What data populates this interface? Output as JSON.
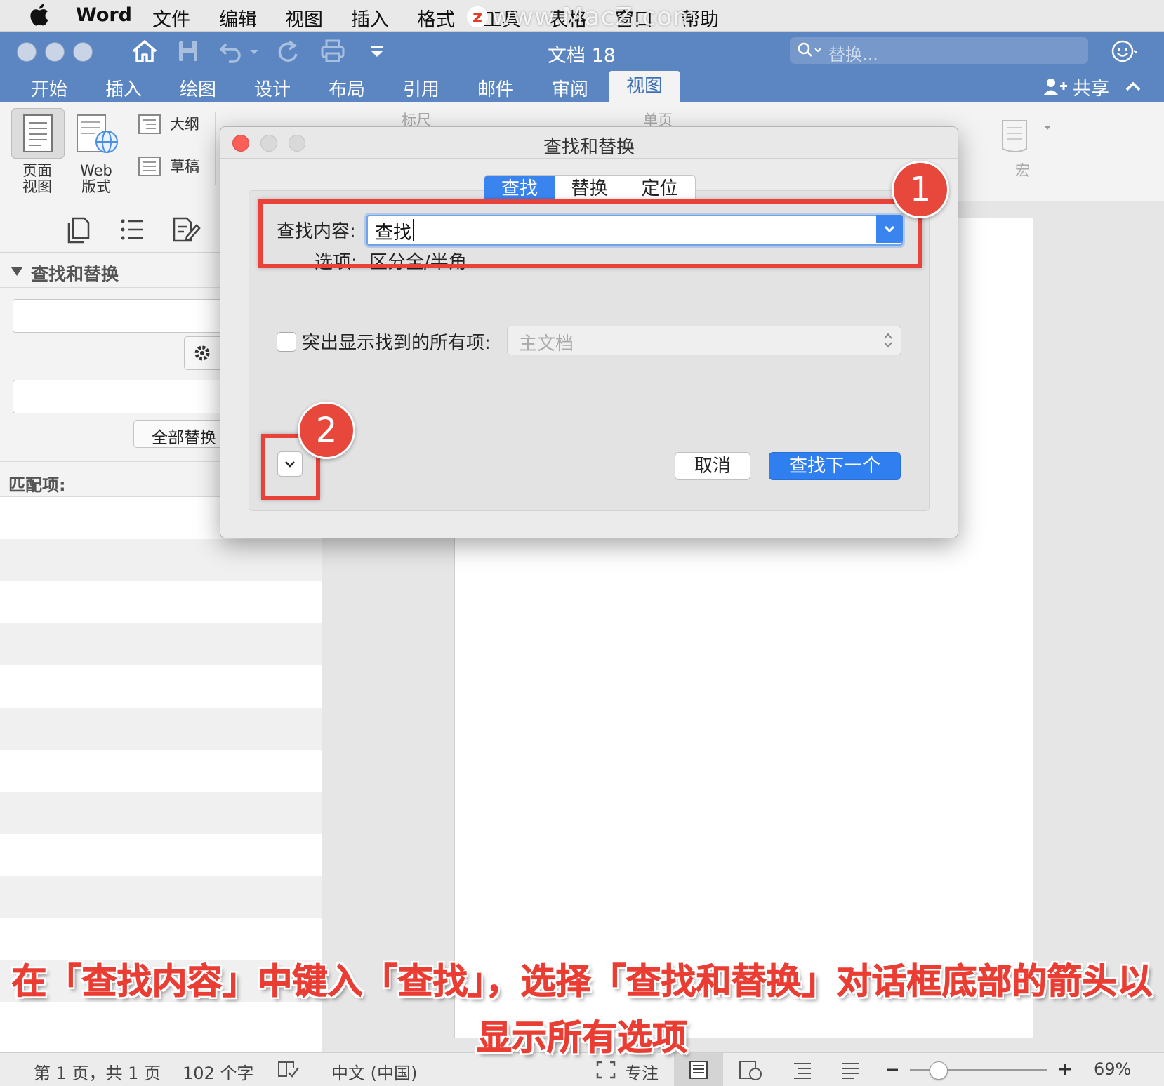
{
  "menubar": {
    "app": "Word",
    "items": [
      "文件",
      "编辑",
      "视图",
      "插入",
      "格式",
      "工具",
      "表格",
      "窗口",
      "帮助"
    ],
    "watermark": "www.MacZ.com",
    "watermark_logo": "z"
  },
  "window": {
    "title": "文档 18",
    "search_placeholder": "替换...",
    "share_label": "共享"
  },
  "ribbon": {
    "tabs": [
      "开始",
      "插入",
      "绘图",
      "设计",
      "布局",
      "引用",
      "邮件",
      "审阅",
      "视图"
    ],
    "active_tab": "视图",
    "view_items": {
      "page_view": "页面\n视图",
      "web_view": "Web\n版式",
      "outline": "大纲",
      "draft": "草稿",
      "ruler": "标尺",
      "single_page": "单页",
      "macro": "宏"
    }
  },
  "left_pane": {
    "section_title": "查找和替换",
    "replace_all_label": "全部替换",
    "matches_label": "匹配项:"
  },
  "dialog": {
    "title": "查找和替换",
    "tabs": [
      "查找",
      "替换",
      "定位"
    ],
    "active_tab": "查找",
    "find_label": "查找内容:",
    "find_value": "查找",
    "options_label": "选项:",
    "options_value": "区分全/半角",
    "highlight_label": "突出显示找到的所有项:",
    "highlight_checked": false,
    "scope_value": "主文档",
    "cancel_label": "取消",
    "find_next_label": "查找下一个"
  },
  "annotations": {
    "badge_1": "1",
    "badge_2": "2",
    "caption_line1": "在「查找内容」中键入「查找」，选择「查找和替换」对话框底部的箭头以",
    "caption_line2": "显示所有选项",
    "accent_color": "#e8423a"
  },
  "statusbar": {
    "page": "第 1 页，共 1 页",
    "words": "102 个字",
    "language": "中文 (中国)",
    "focus": "专注",
    "zoom_text": "69%",
    "zoom_level": 0.69
  },
  "colors": {
    "titlebar": "#5b86c2",
    "primary_button": "#2f7ff0"
  }
}
